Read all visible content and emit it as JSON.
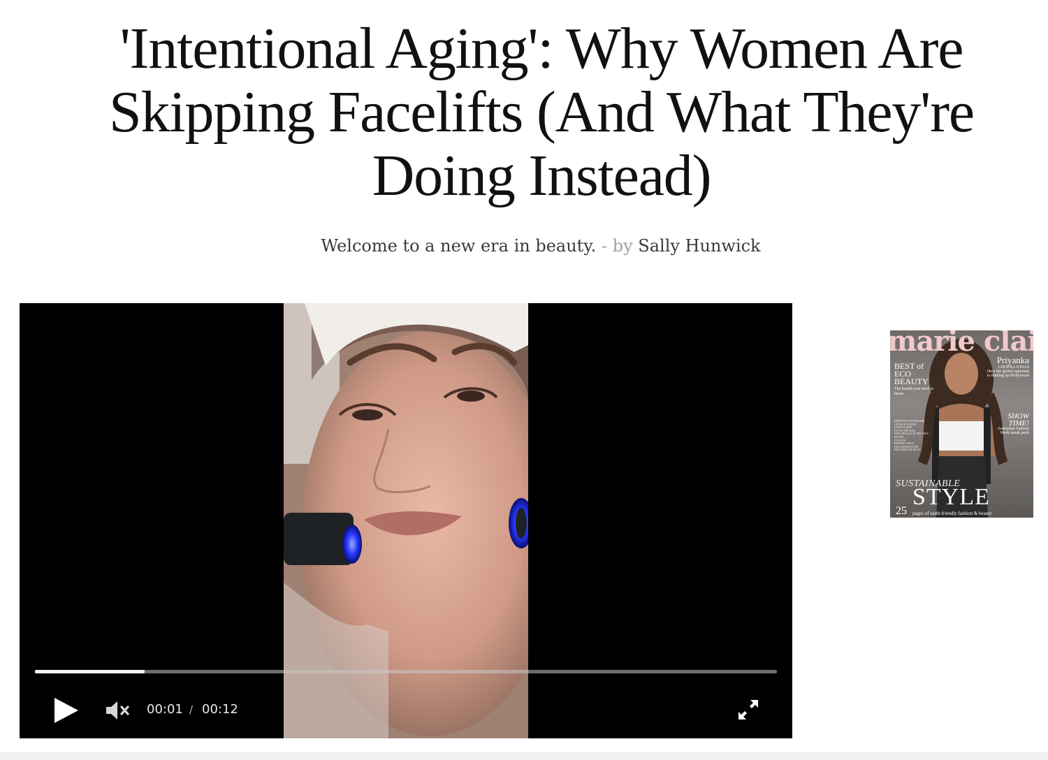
{
  "article": {
    "headline": "'Intentional Aging': Why Women Are Skipping Facelifts (And What They're Doing Instead)",
    "standfirst": "Welcome to a new era in beauty.",
    "separator": "-",
    "by_label": "by",
    "author": "Sally Hunwick"
  },
  "video_player": {
    "current_time": "00:01",
    "time_separator": "/",
    "duration": "00:12",
    "progress": 0.148,
    "muted": true,
    "icons": {
      "play": "play-icon",
      "mute": "volume-muted-icon",
      "fullscreen": "fullscreen-icon"
    }
  },
  "magazine_cover": {
    "masthead": "marie claire",
    "cover_star": "Priyanka",
    "cover_star_sub": "CHOPRA JONAS",
    "cover_star_blurb": "How the global superstar is shaking up Hollywood",
    "left_feature": "BEST of ECO BEAUTY",
    "left_feature_blurb": "The brands you need to know",
    "mini_lines": [
      "IMPOSTER SYNDROME",
      "LIVES OF CELEB LOOKALIKES",
      "IT'S IN THE BAG",
      "WHY RESALE IS THE NEW RETAIL",
      "EYE EYE",
      "BEHIND LINGS",
      "HAS MINIMALISM REACHED ITS MAX?"
    ],
    "right_feature": "SHOW TIME!",
    "right_feature_blurb": "Australian Fashion Week sneak peek",
    "bottom_kicker": "SUSTAINABLE",
    "bottom_title": "STYLE",
    "bottom_number": "25",
    "bottom_blurb": "pages of earth-friendly fashion & beauty"
  },
  "colors": {
    "background": "#ffffff",
    "headline": "#111111",
    "byline_muted": "#a0a0a0",
    "player_bg": "#000000",
    "masthead_pink": "#f0c9cc"
  }
}
